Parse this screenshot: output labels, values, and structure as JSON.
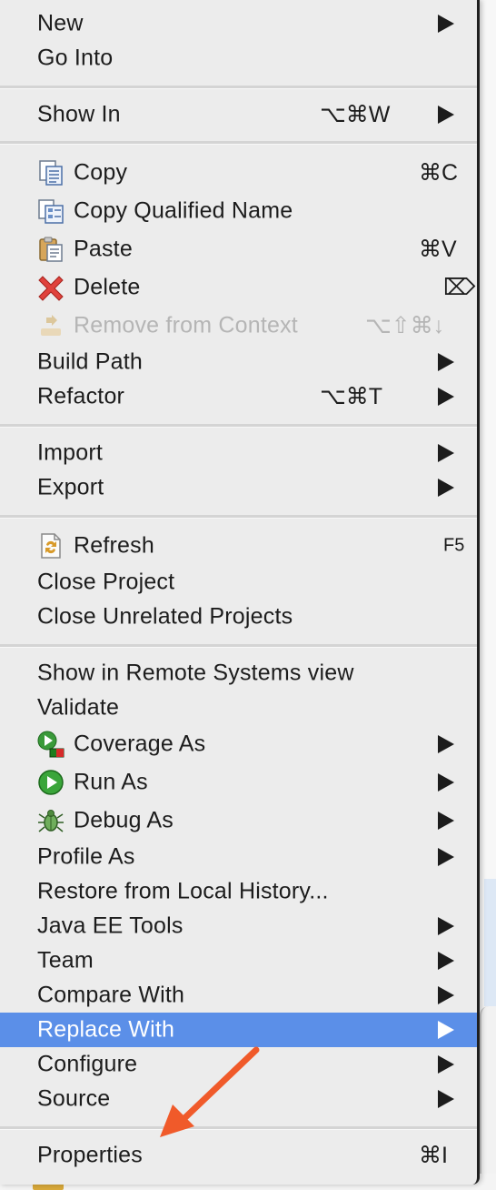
{
  "menu": {
    "new": {
      "label": "New",
      "icon": "",
      "shortcut": ""
    },
    "go_into": {
      "label": "Go Into"
    },
    "show_in": {
      "label": "Show In",
      "shortcut": "⌥⌘W"
    },
    "copy": {
      "label": "Copy",
      "icon": "copy-icon",
      "shortcut": "⌘C"
    },
    "copy_qualified_name": {
      "label": "Copy Qualified Name",
      "icon": "copy-qualified-name-icon"
    },
    "paste": {
      "label": "Paste",
      "icon": "paste-icon",
      "shortcut": "⌘V"
    },
    "delete": {
      "label": "Delete",
      "icon": "delete-icon",
      "shortcut": "⌦"
    },
    "remove_from_context": {
      "label": "Remove from Context",
      "icon": "remove-from-context-icon",
      "shortcut": "⌥⇧⌘↓",
      "disabled": true
    },
    "build_path": {
      "label": "Build Path"
    },
    "refactor": {
      "label": "Refactor",
      "shortcut": "⌥⌘T"
    },
    "import": {
      "label": "Import"
    },
    "export": {
      "label": "Export"
    },
    "refresh": {
      "label": "Refresh",
      "icon": "refresh-icon",
      "shortcut": "F5"
    },
    "close_project": {
      "label": "Close Project"
    },
    "close_unrelated_projects": {
      "label": "Close Unrelated Projects"
    },
    "show_in_remote_systems_view": {
      "label": "Show in Remote Systems view"
    },
    "validate": {
      "label": "Validate"
    },
    "coverage_as": {
      "label": "Coverage As",
      "icon": "coverage-icon"
    },
    "run_as": {
      "label": "Run As",
      "icon": "run-icon"
    },
    "debug_as": {
      "label": "Debug As",
      "icon": "debug-bug-icon"
    },
    "profile_as": {
      "label": "Profile As"
    },
    "restore_from_local_history": {
      "label": "Restore from Local History..."
    },
    "java_ee_tools": {
      "label": "Java EE Tools"
    },
    "team": {
      "label": "Team"
    },
    "compare_with": {
      "label": "Compare With"
    },
    "replace_with": {
      "label": "Replace With",
      "selected": true
    },
    "configure": {
      "label": "Configure"
    },
    "source": {
      "label": "Source"
    },
    "properties": {
      "label": "Properties",
      "shortcut": "⌘I"
    }
  },
  "colors": {
    "menu_background": "#ececec",
    "selection": "#5b8fe8",
    "disabled_text": "#b5b5b5",
    "annotation_arrow": "#f05a2a"
  }
}
